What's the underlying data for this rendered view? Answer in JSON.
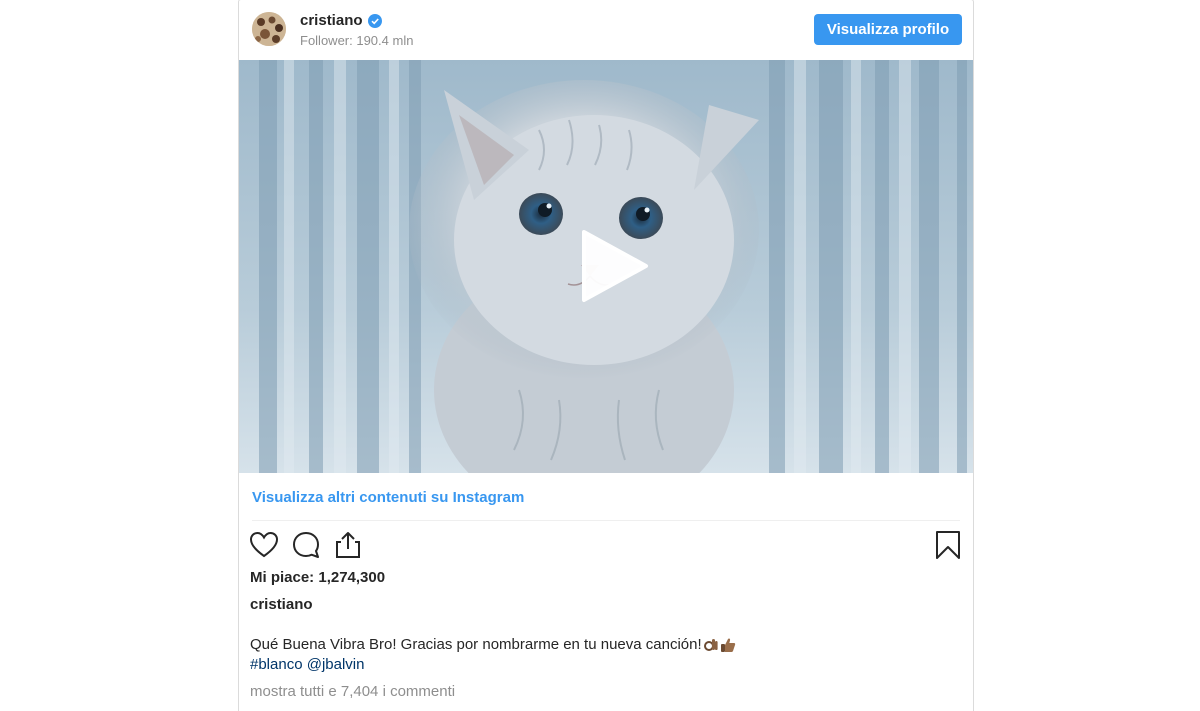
{
  "post": {
    "username": "cristiano",
    "followers": "Follower: 190.4 mln",
    "view_profile": "Visualizza profilo",
    "more_content": "Visualizza altri contenuti su Instagram",
    "likes": "Mi piace: 1,274,300",
    "caption_user": "cristiano",
    "caption": "Qué Buena Vibra Bro! Gracias por nombrarme en tu nueva canción!",
    "hashtag": "#blanco",
    "mention": "@jbalvin",
    "comments_link": "mostra tutti e 7,404 i commenti"
  },
  "icons": {
    "verified": "verified-badge-icon",
    "play": "play-icon",
    "like": "heart-icon",
    "comment": "comment-icon",
    "share": "share-icon",
    "save": "bookmark-icon",
    "caption_emojis": [
      "ok-hand-emoji",
      "thumbs-up-emoji"
    ]
  },
  "colors": {
    "accent": "#3897f0",
    "link": "#003569",
    "muted": "#8e8e8e",
    "border": "#dbdbdb"
  }
}
